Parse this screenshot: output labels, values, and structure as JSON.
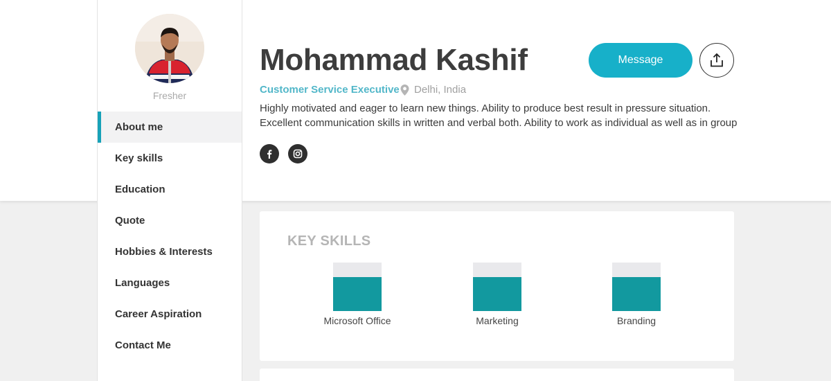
{
  "profile": {
    "name": "Mohammad Kashif",
    "title": "Customer Service Executive",
    "location": "Delhi, India",
    "status": "Fresher",
    "bio": "Highly motivated and eager to learn new things. Ability to produce best result in pressure situation. Excellent communication skills in written and verbal both. Ability to work as individual as well as in group"
  },
  "actions": {
    "message_label": "Message"
  },
  "nav": {
    "items": [
      {
        "label": "About me",
        "active": true
      },
      {
        "label": "Key skills"
      },
      {
        "label": "Education"
      },
      {
        "label": "Quote"
      },
      {
        "label": "Hobbies & Interests"
      },
      {
        "label": "Languages"
      },
      {
        "label": "Career Aspiration"
      },
      {
        "label": "Contact Me"
      }
    ]
  },
  "social": [
    "facebook-icon",
    "instagram-icon"
  ],
  "key_skills": {
    "title": "KEY SKILLS",
    "skills": [
      {
        "name": "Microsoft Office",
        "level": 0.7
      },
      {
        "name": "Marketing",
        "level": 0.7
      },
      {
        "name": "Branding",
        "level": 0.7
      }
    ]
  },
  "colors": {
    "accent": "#17b0c9",
    "skill_fill": "#12999f",
    "title_teal": "#52b7c9"
  }
}
